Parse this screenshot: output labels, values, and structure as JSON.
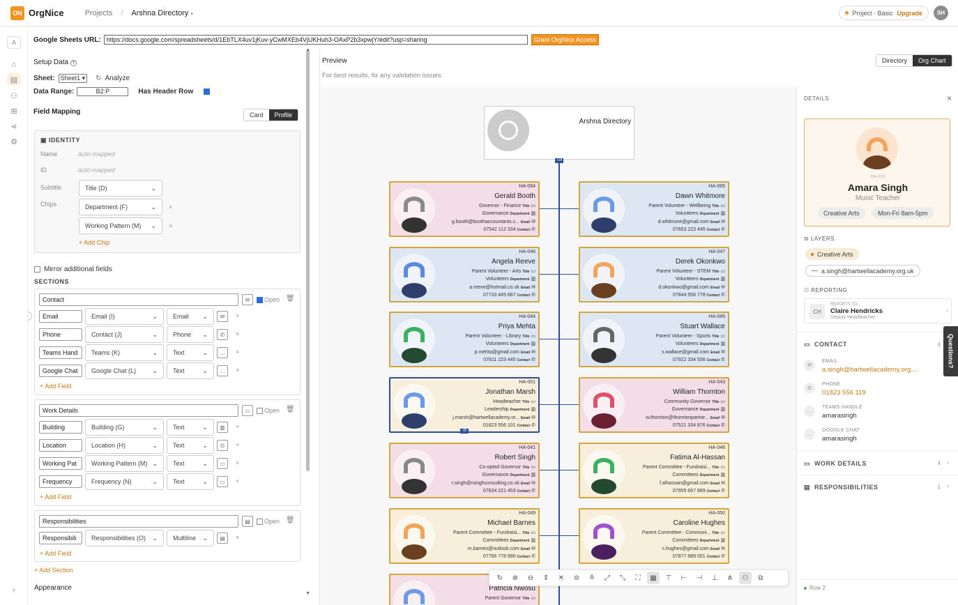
{
  "app": {
    "logo": "ON",
    "name": "OrgNice",
    "crumb1": "Projects",
    "crumb2": "Arshna Directory",
    "plan": "Project · Basic",
    "upgrade": "Upgrade",
    "avatar": "SH"
  },
  "url": {
    "label": "Google Sheets URL:",
    "value": "https://docs.google.com/spreadsheets/d/1EbTLX4uv1jKuv-yCwMXEb4VjUKHuh3-OAxP2b3xpwjY/edit?usp=sharing",
    "button": "Grant OrgNice Access"
  },
  "setup": {
    "title": "Setup Data",
    "sheet_label": "Sheet:",
    "sheet_value": "Sheet1",
    "analyze": "Analyze",
    "range_label": "Data Range:",
    "range_value": "B2:P",
    "header_label": "Has Header Row",
    "mapping": "Field Mapping",
    "card": "Card",
    "profile": "Profile",
    "identity": "IDENTITY",
    "name_lbl": "Name",
    "id_lbl": "ID",
    "auto": "auto-mapped",
    "subtitle_lbl": "Subtitle",
    "subtitle_val": "Title (D)",
    "chips_lbl": "Chips",
    "chip1": "Department (F)",
    "chip2": "Working Pattern (M)",
    "add_chip": "+ Add Chip",
    "mirror": "Mirror additional fields",
    "sections": "SECTIONS",
    "open": "Open",
    "add_field": "+ Add Field",
    "add_section": "+ Add Section",
    "appearance": "Appearance"
  },
  "sections": [
    {
      "name": "Contact",
      "open": true,
      "fields": [
        [
          "Email",
          "Email (I)",
          "Email"
        ],
        [
          "Phone",
          "Contact (J)",
          "Phone"
        ],
        [
          "Teams Hand",
          "Teams (K)",
          "Text"
        ],
        [
          "Google Chat",
          "Google Chat (L)",
          "Text"
        ]
      ]
    },
    {
      "name": "Work Details",
      "open": false,
      "fields": [
        [
          "Building",
          "Building (G)",
          "Text"
        ],
        [
          "Location",
          "Location (H)",
          "Text"
        ],
        [
          "Working Pat",
          "Working Pattern (M)",
          "Text"
        ],
        [
          "Frequency",
          "Frequency (N)",
          "Text"
        ]
      ]
    },
    {
      "name": "Responsibilities",
      "open": false,
      "fields": [
        [
          "Responsibili",
          "Responsibilities (O)",
          "Multiline"
        ]
      ]
    }
  ],
  "preview": {
    "title": "Preview",
    "hint": "For best results, fix any validation issues.",
    "tab1": "Directory",
    "tab2": "Org Chart",
    "root": "Arshna Directory",
    "title_tag": "Title",
    "dept_tag": "Department",
    "email_tag": "Email",
    "contact_tag": "Contact",
    "badge_top": "+18",
    "badge_mid": "+8"
  },
  "nodes": [
    {
      "id": "HA-064",
      "name": "Gerald Booth",
      "title": "Governor - Finance",
      "dept": "Governance",
      "email": "g.booth@boothaccountants.c...",
      "phone": "07542 112 334",
      "bg": "#f3dde6",
      "c1": "#8a8a8a",
      "c2": "#333"
    },
    {
      "id": "HA-065",
      "name": "Dawn Whitmore",
      "title": "Parent Volunteer - Wellbeing",
      "dept": "Volunteers",
      "email": "d.whitmore@gmail.com",
      "phone": "07653 223 445",
      "bg": "#dde6f3",
      "c1": "#6b9be8",
      "c2": "#2d3f6a"
    },
    {
      "id": "HA-046",
      "name": "Angela Reeve",
      "title": "Parent Volunteer - Arts",
      "dept": "Volunteers",
      "email": "a.reeve@hotmail.co.uk",
      "phone": "07733 445 667",
      "bg": "#dde6f3",
      "c1": "#5a8ae0",
      "c2": "#2d3f6a"
    },
    {
      "id": "HA-047",
      "name": "Derek Okonkwo",
      "title": "Parent Volunteer - STEM",
      "dept": "Volunteers",
      "email": "d.okonkwo@gmail.com",
      "phone": "07844 556 778",
      "bg": "#dde6f3",
      "c1": "#f2a55a",
      "c2": "#6a4020"
    },
    {
      "id": "HA-044",
      "name": "Priya Mehta",
      "title": "Parent Volunteer - Library",
      "dept": "Volunteers",
      "email": "p.mehta@gmail.com",
      "phone": "07811 223 445",
      "bg": "#dde6f3",
      "c1": "#3ab060",
      "c2": "#234a30"
    },
    {
      "id": "HA-045",
      "name": "Stuart Wallace",
      "title": "Parent Volunteer - Sports",
      "dept": "Volunteers",
      "email": "s.wallace@gmail.com",
      "phone": "07922 334 556",
      "bg": "#dde6f3",
      "c1": "#666",
      "c2": "#333"
    },
    {
      "id": "HA-001",
      "name": "Jonathan Marsh",
      "title": "Headteacher",
      "dept": "Leadership",
      "email": "j.marsh@hartwellacademy.or...",
      "phone": "01823 556 101",
      "bg": "#f7efdc",
      "c1": "#6b9be8",
      "c2": "#2d3f6a"
    },
    {
      "id": "HA-043",
      "name": "William Thornton",
      "title": "Community Governor",
      "dept": "Governance",
      "email": "w.thornton@thorntonpartne...",
      "phone": "07521 334 876",
      "bg": "#f3dde6",
      "c1": "#e0506a",
      "c2": "#6a2030"
    },
    {
      "id": "HA-041",
      "name": "Robert Singh",
      "title": "Co-opted Governor",
      "dept": "Governance",
      "email": "r.singh@rsinghconsulting.co.uk",
      "phone": "07634 221 453",
      "bg": "#f3dde6",
      "c1": "#888",
      "c2": "#333"
    },
    {
      "id": "HA-048",
      "name": "Fatima Al-Hassan",
      "title": "Parent Committee - Fundraisi...",
      "dept": "Committees",
      "email": "f.alhassan@gmail.com",
      "phone": "07955 667 889",
      "bg": "#f7efdc",
      "c1": "#3ab060",
      "c2": "#234a30"
    },
    {
      "id": "HA-049",
      "name": "Michael Barnes",
      "title": "Parent Committee - Fundraisi...",
      "dept": "Committees",
      "email": "m.barnes@outlook.com",
      "phone": "07766 778 990",
      "bg": "#f7efdc",
      "c1": "#f2a55a",
      "c2": "#6a4020"
    },
    {
      "id": "HA-050",
      "name": "Caroline Hughes",
      "title": "Parent Committee - Communi...",
      "dept": "Committees",
      "email": "c.hughes@gmail.com",
      "phone": "07877 889 001",
      "bg": "#f7efdc",
      "c1": "#a050d0",
      "c2": "#4a2060"
    },
    {
      "id": "",
      "name": "Patricia Nwosu",
      "title": "Parent Governor",
      "dept": "",
      "email": "",
      "phone": "",
      "bg": "#f3dde6",
      "c1": "#6b9be8",
      "c2": "#2d3f6a"
    }
  ],
  "details": {
    "title": "DETAILS",
    "pid": "HA-013",
    "name": "Amara Singh",
    "role": "Music Teacher",
    "chip1": "Creative Arts",
    "chip2": "Mon-Fri 8am-5pm",
    "layers": "LAYERS",
    "layer1": "Creative Arts",
    "layer2": "a.singh@hartwellacademy.org.uk",
    "reporting": "REPORTING",
    "reports_to": "REPORTS TO",
    "mgr_init": "CH",
    "mgr_name": "Claire Hendricks",
    "mgr_title": "Deputy Headteacher",
    "contact": "CONTACT",
    "contact_n": "4",
    "email_l": "EMAIL",
    "email_v": "a.singh@hartwellacademy.org....",
    "phone_l": "PHONE",
    "phone_v": "01823 556 119",
    "teams_l": "TEAMS HANDLE",
    "teams_v": "amarasingh",
    "gchat_l": "GOOGLE CHAT",
    "gchat_v": "amarasingh",
    "work": "WORK DETAILS",
    "work_n": "4",
    "resp": "RESPONSIBILITIES",
    "resp_n": "1",
    "row": "Row 2",
    "questions": "Questions?"
  },
  "colors": {
    "accent": "#f29422",
    "card_border": "#d4a53a",
    "selected": "#2d4d9a"
  }
}
